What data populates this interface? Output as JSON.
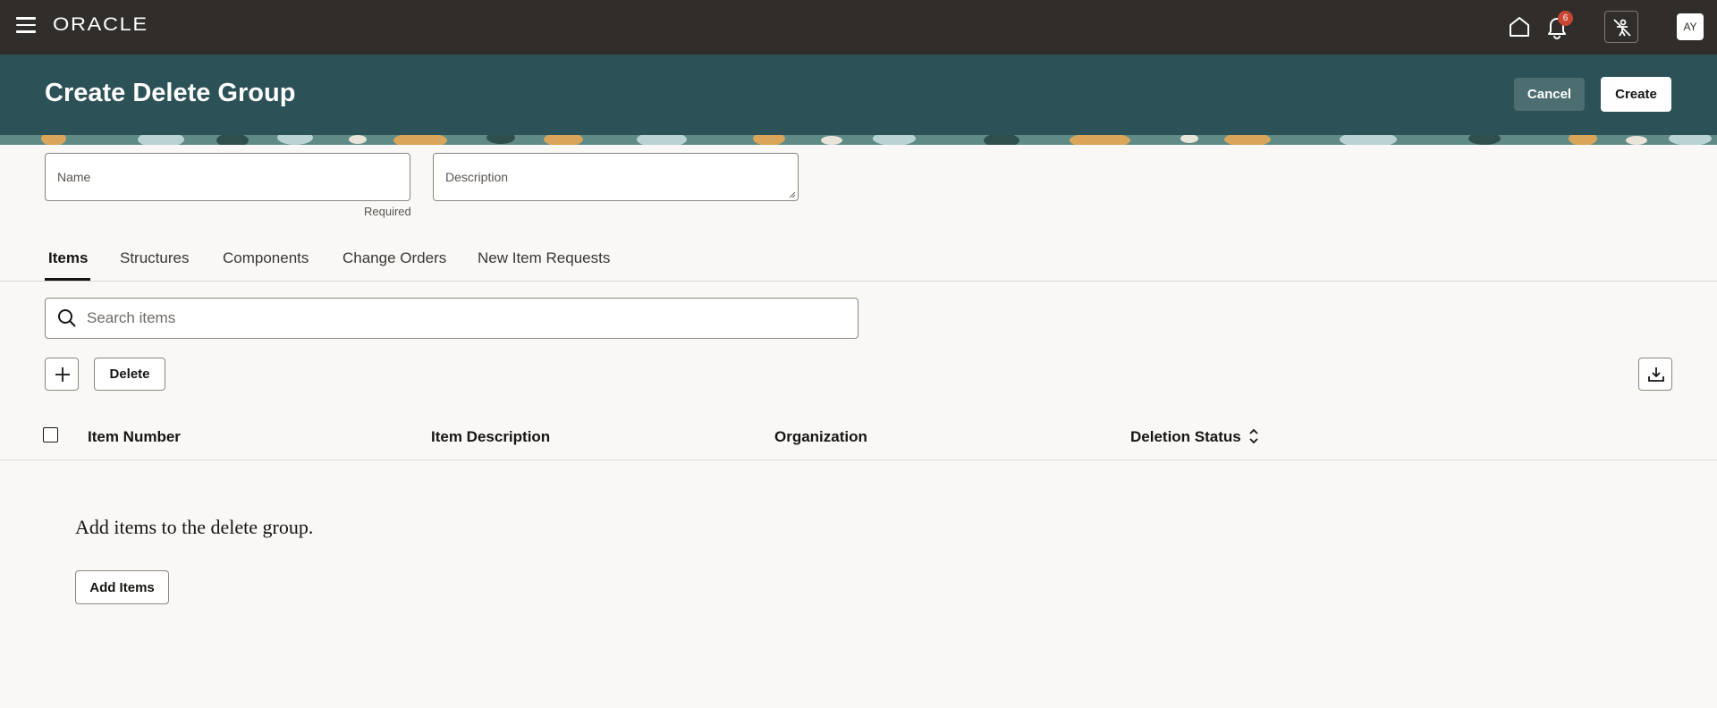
{
  "topbar": {
    "logo": "ORACLE",
    "notification_count": "6",
    "avatar_initials": "AY"
  },
  "header": {
    "title": "Create Delete Group",
    "cancel_label": "Cancel",
    "create_label": "Create"
  },
  "form": {
    "name_label": "Name",
    "name_hint": "Required",
    "description_label": "Description"
  },
  "tabs": [
    {
      "label": "Items",
      "active": true
    },
    {
      "label": "Structures",
      "active": false
    },
    {
      "label": "Components",
      "active": false
    },
    {
      "label": "Change Orders",
      "active": false
    },
    {
      "label": "New Item Requests",
      "active": false
    }
  ],
  "search": {
    "placeholder": "Search items"
  },
  "toolbar": {
    "delete_label": "Delete"
  },
  "table": {
    "columns": [
      "Item Number",
      "Item Description",
      "Organization",
      "Deletion Status"
    ]
  },
  "empty_state": {
    "message": "Add items to the delete group.",
    "button_label": "Add Items"
  },
  "colors": {
    "topbar": "#312d2a",
    "header": "#2c5156",
    "notification_badge": "#c74634"
  }
}
